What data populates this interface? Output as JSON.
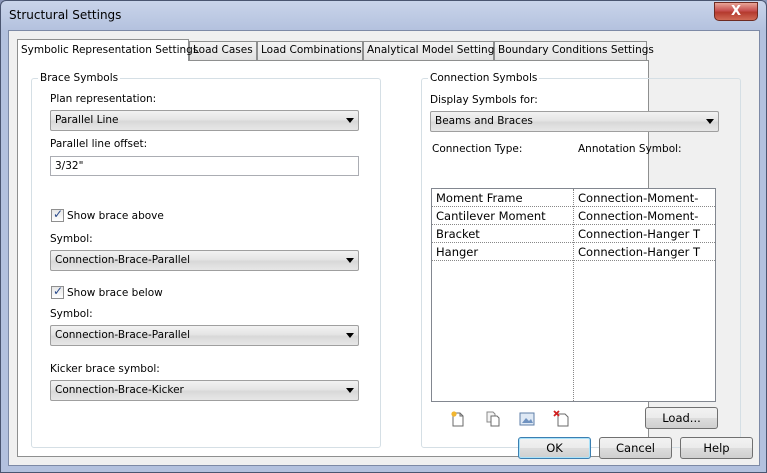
{
  "window": {
    "title": "Structural Settings",
    "close_label": "X"
  },
  "tabs": [
    {
      "label": "Symbolic Representation Settings",
      "active": true
    },
    {
      "label": "Load Cases",
      "active": false
    },
    {
      "label": "Load Combinations",
      "active": false
    },
    {
      "label": "Analytical Model Settings",
      "active": false
    },
    {
      "label": "Boundary Conditions Settings",
      "active": false
    }
  ],
  "brace_symbols": {
    "group_label": "Brace Symbols",
    "plan_representation_label": "Plan representation:",
    "plan_representation_value": "Parallel Line",
    "parallel_offset_label": "Parallel line offset:",
    "parallel_offset_value": "3/32\"",
    "show_above_label": "Show brace above",
    "show_above_checked": true,
    "symbol_above_label": "Symbol:",
    "symbol_above_value": "Connection-Brace-Parallel",
    "show_below_label": "Show brace below",
    "show_below_checked": true,
    "symbol_below_label": "Symbol:",
    "symbol_below_value": "Connection-Brace-Parallel",
    "kicker_label": "Kicker brace symbol:",
    "kicker_value": "Connection-Brace-Kicker"
  },
  "connection_symbols": {
    "group_label": "Connection Symbols",
    "display_for_label": "Display Symbols for:",
    "display_for_value": "Beams and Braces",
    "col_type": "Connection Type:",
    "col_annotation": "Annotation Symbol:",
    "rows": [
      {
        "type": "Moment Frame",
        "annotation": "Connection-Moment-"
      },
      {
        "type": "Cantilever Moment",
        "annotation": "Connection-Moment-"
      },
      {
        "type": "Bracket",
        "annotation": "Connection-Hanger T"
      },
      {
        "type": "Hanger",
        "annotation": "Connection-Hanger T"
      }
    ],
    "load_label": "Load..."
  },
  "footer": {
    "ok_label": "OK",
    "cancel_label": "Cancel",
    "help_label": "Help"
  }
}
